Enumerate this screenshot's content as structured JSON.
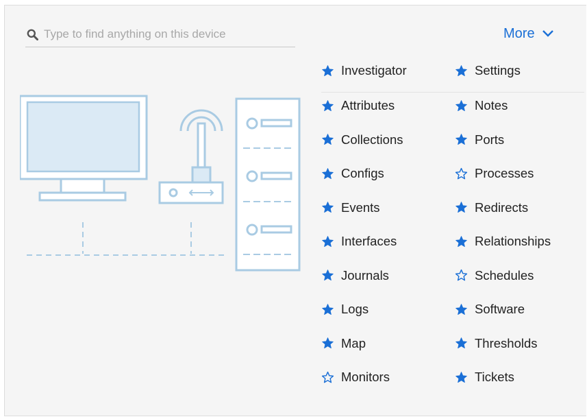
{
  "search": {
    "placeholder": "Type to find anything on this device"
  },
  "more": {
    "label": "More"
  },
  "colors": {
    "accent": "#1a6fd6",
    "illustration": "#a9cbe3"
  },
  "links": [
    {
      "label": "Investigator",
      "favorite": true
    },
    {
      "label": "Settings",
      "favorite": true
    },
    {
      "label": "Attributes",
      "favorite": true
    },
    {
      "label": "Notes",
      "favorite": true
    },
    {
      "label": "Collections",
      "favorite": true
    },
    {
      "label": "Ports",
      "favorite": true
    },
    {
      "label": "Configs",
      "favorite": true
    },
    {
      "label": "Processes",
      "favorite": false
    },
    {
      "label": "Events",
      "favorite": true
    },
    {
      "label": "Redirects",
      "favorite": true
    },
    {
      "label": "Interfaces",
      "favorite": true
    },
    {
      "label": "Relationships",
      "favorite": true
    },
    {
      "label": "Journals",
      "favorite": true
    },
    {
      "label": "Schedules",
      "favorite": false
    },
    {
      "label": "Logs",
      "favorite": true
    },
    {
      "label": "Software",
      "favorite": true
    },
    {
      "label": "Map",
      "favorite": true
    },
    {
      "label": "Thresholds",
      "favorite": true
    },
    {
      "label": "Monitors",
      "favorite": false
    },
    {
      "label": "Tickets",
      "favorite": true
    }
  ]
}
